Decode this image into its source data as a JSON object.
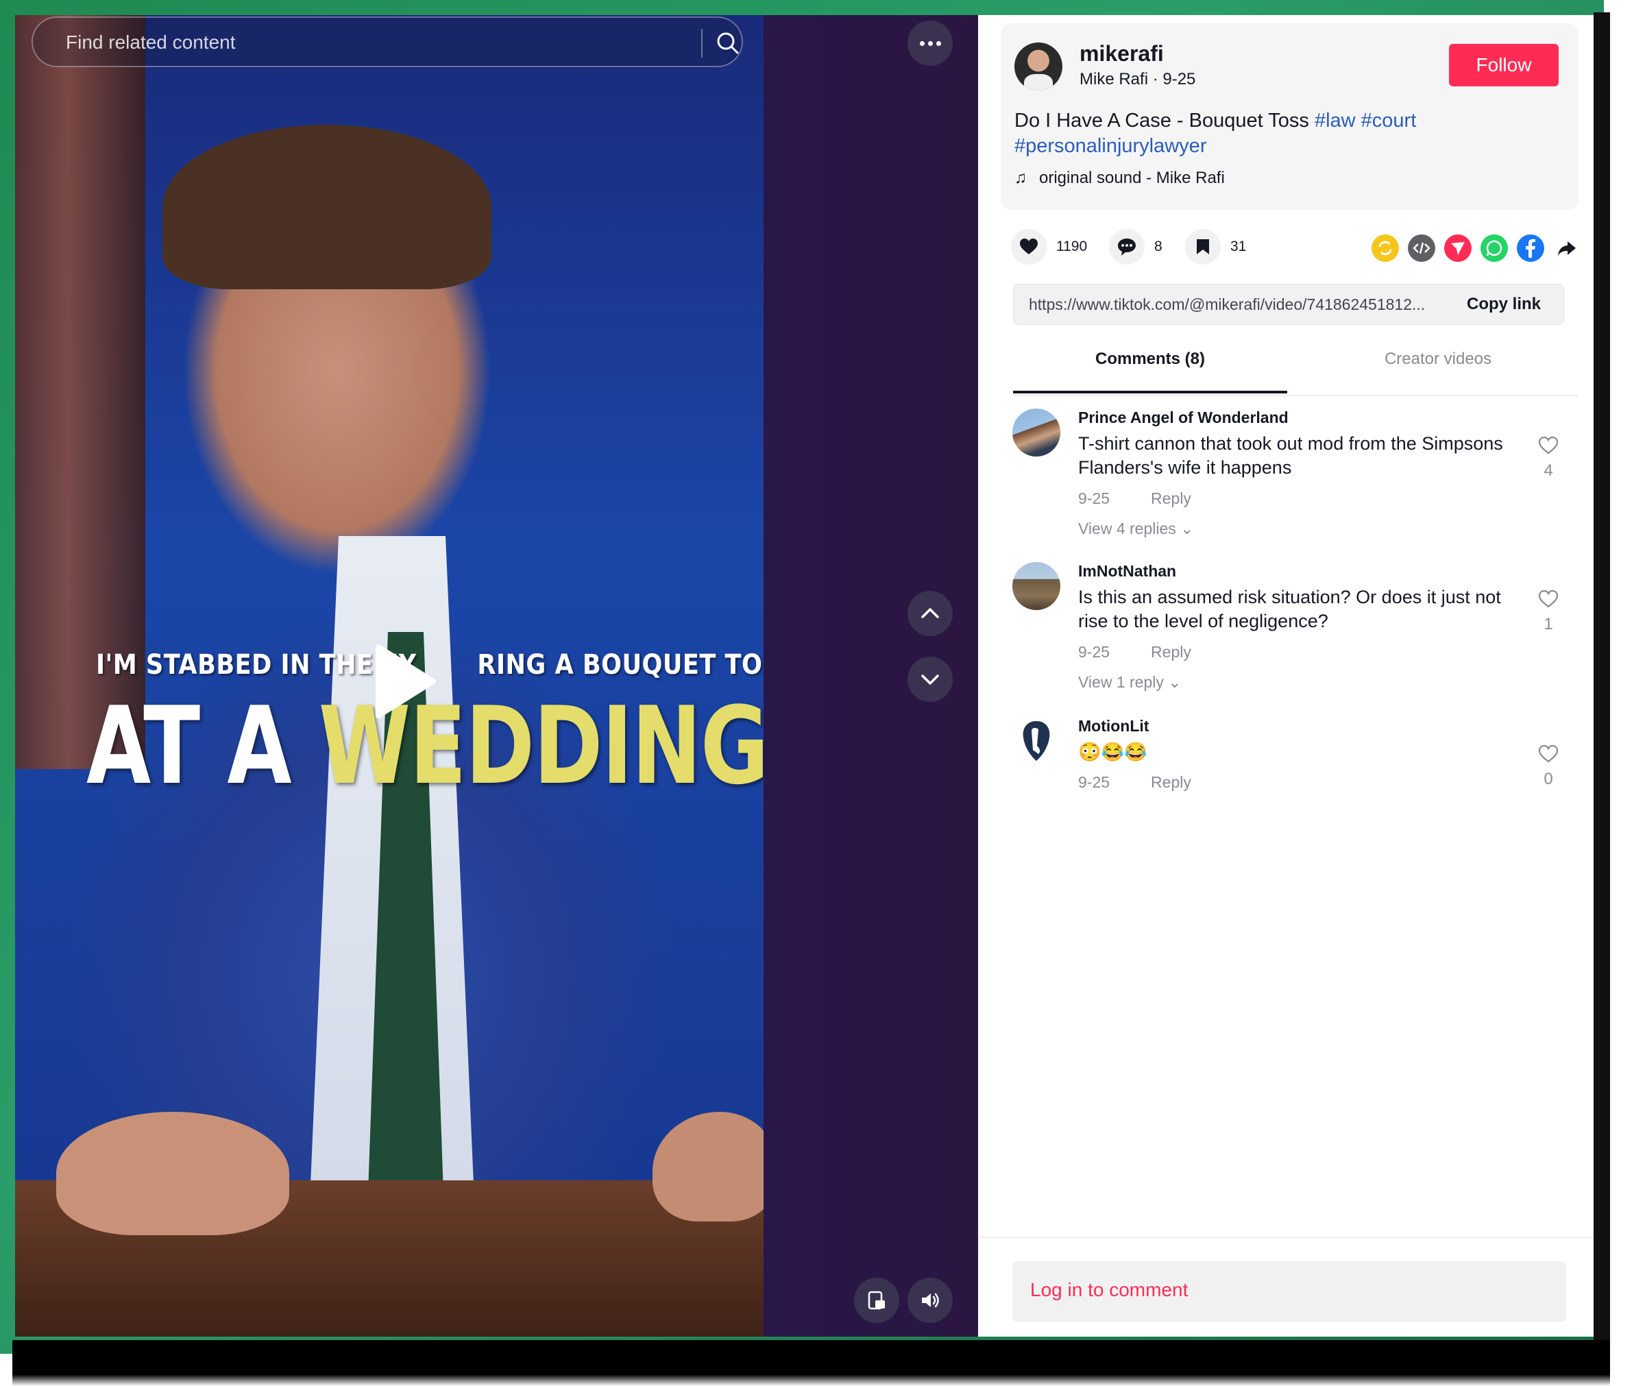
{
  "search": {
    "placeholder": "Find related content"
  },
  "video": {
    "caption_line1": "I'M STABBED IN THE EY",
    "caption_line1_b": "RING A BOUQUET TOSS",
    "caption_line2_a": "AT A ",
    "caption_line2_b": "WEDDING"
  },
  "post": {
    "username": "mikerafi",
    "subname": "Mike Rafi · 9-25",
    "follow_label": "Follow",
    "description": "Do I Have A Case - Bouquet Toss ",
    "tags": [
      "#law",
      "#court",
      "#personalinjurylawyer"
    ],
    "sound": "original sound - Mike Rafi"
  },
  "stats": {
    "likes": "1190",
    "comments": "8",
    "saves": "31"
  },
  "share_icons": [
    {
      "name": "repost-icon",
      "color": "#f6c61d"
    },
    {
      "name": "embed-icon",
      "color": "#5e5e63"
    },
    {
      "name": "send-icon",
      "color": "#fe2c55"
    },
    {
      "name": "whatsapp-icon",
      "color": "#25d366"
    },
    {
      "name": "facebook-icon",
      "color": "#1877f2"
    }
  ],
  "link": {
    "url": "https://www.tiktok.com/@mikerafi/video/741862451812...",
    "copy_label": "Copy link"
  },
  "tabs": {
    "comments": "Comments (8)",
    "creator": "Creator videos"
  },
  "comments": [
    {
      "name": "Prince Angel of Wonderland",
      "text": "T-shirt cannon that took out mod from the Simpsons Flanders's wife it happens",
      "date": "9-25",
      "reply": "Reply",
      "replies": "View 4 replies",
      "likes": "4"
    },
    {
      "name": "ImNotNathan",
      "text": "Is this an assumed risk situation? Or does it just not rise to the level of negligence?",
      "date": "9-25",
      "reply": "Reply",
      "replies": "View 1 reply",
      "likes": "1"
    },
    {
      "name": "MotionLit",
      "text": "😳😂😂",
      "date": "9-25",
      "reply": "Reply",
      "likes": "0"
    }
  ],
  "login_label": "Log in to comment"
}
